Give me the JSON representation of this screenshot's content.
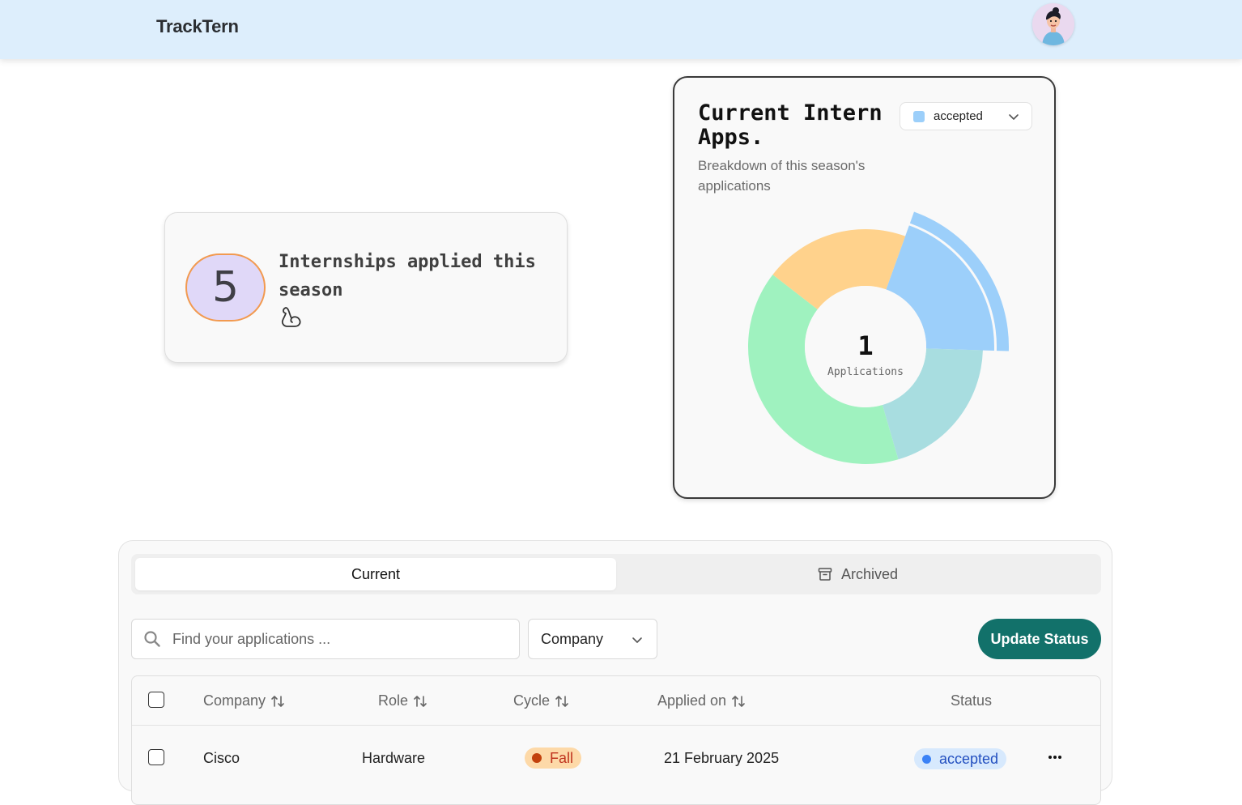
{
  "app": {
    "brand": "TrackTern"
  },
  "stat": {
    "value": "5",
    "label": "Internships applied this season"
  },
  "chart_card": {
    "title": "Current Intern Apps.",
    "subtitle": "Breakdown of this season's applications",
    "filter": {
      "selected": "accepted",
      "swatch_color": "#9ccffa"
    },
    "center_value": "1",
    "center_label": "Applications"
  },
  "chart_data": {
    "type": "pie",
    "subtype": "donut",
    "active_slice": "accepted",
    "slices": [
      {
        "value": 1,
        "color": "#9ccffa"
      },
      {
        "value": 1,
        "color": "#a8dde0"
      },
      {
        "value": 2,
        "color": "#9ff2bf"
      },
      {
        "value": 1,
        "color": "#ffd28c"
      }
    ],
    "total": 5
  },
  "tabs": {
    "current": "Current",
    "archived": "Archived"
  },
  "toolbar": {
    "search_placeholder": "Find your applications ...",
    "company_filter": "Company",
    "update_button": "Update Status"
  },
  "table": {
    "headers": {
      "company": "Company",
      "role": "Role",
      "cycle": "Cycle",
      "applied": "Applied on",
      "status": "Status"
    },
    "rows": [
      {
        "company": "Cisco",
        "role": "Hardware",
        "cycle": "Fall",
        "applied": "21 February 2025",
        "status": "accepted"
      }
    ]
  },
  "colors": {
    "accent": "#12716a",
    "header_bg": "#ddeefc"
  }
}
